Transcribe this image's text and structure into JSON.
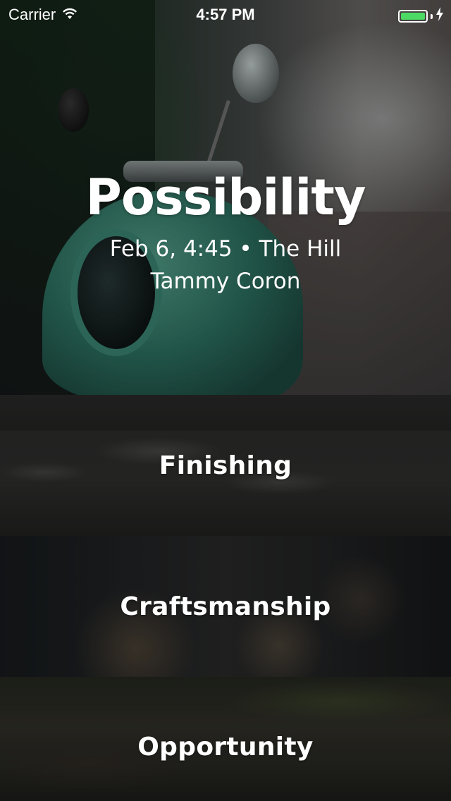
{
  "status_bar": {
    "carrier": "Carrier",
    "time": "4:57 PM",
    "battery_level": 1.0,
    "battery_color": "#4cd964",
    "icons": [
      "wifi-icon",
      "battery-icon",
      "charging-bolt-icon"
    ]
  },
  "hero": {
    "title": "Possibility",
    "meta": "Feb 6, 4:45 • The Hill",
    "author": "Tammy Coron"
  },
  "rows": [
    {
      "label": "Finishing"
    },
    {
      "label": "Craftsmanship"
    },
    {
      "label": "Opportunity"
    }
  ]
}
